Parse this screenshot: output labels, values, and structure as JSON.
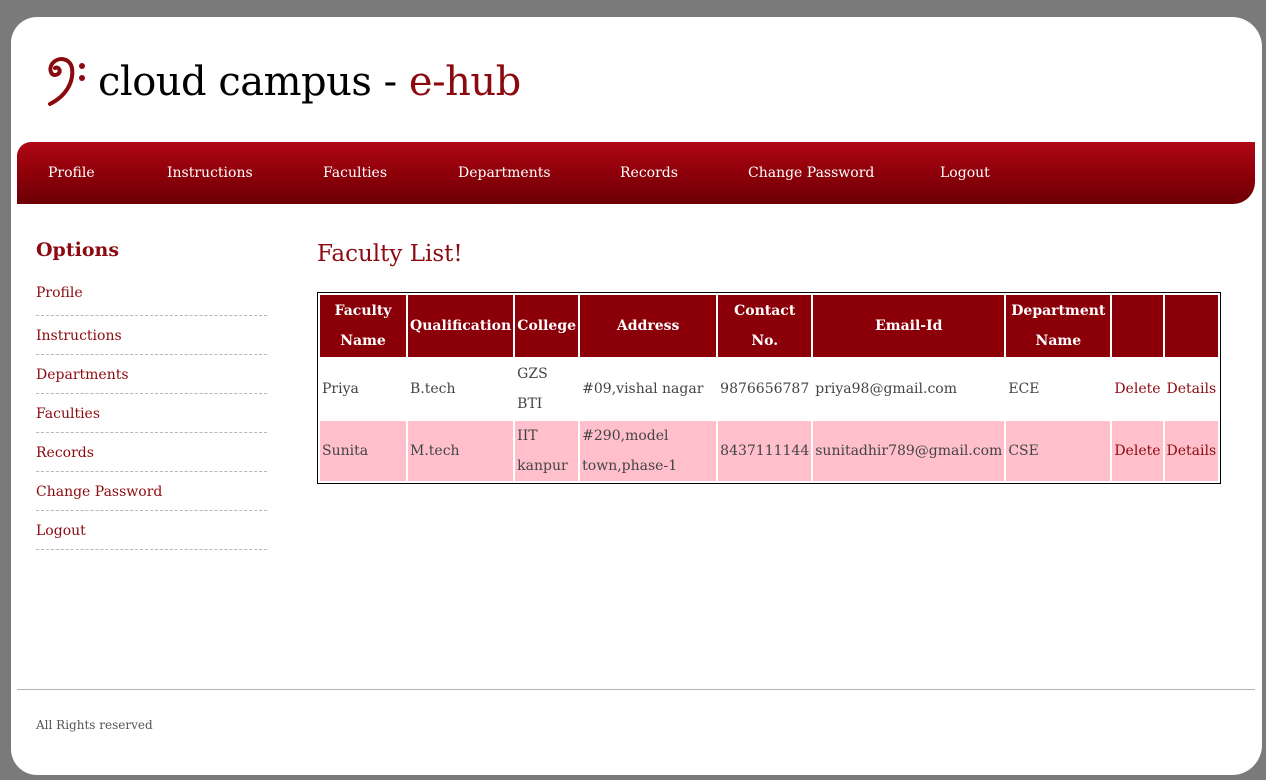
{
  "brand": {
    "name": "cloud campus - ",
    "accent": "e-hub",
    "accent_color": "#8b0a0f",
    "logo_icon": "bass-clef-icon"
  },
  "nav": {
    "items": [
      {
        "label": "Profile"
      },
      {
        "label": "Instructions"
      },
      {
        "label": "Faculties"
      },
      {
        "label": "Departments"
      },
      {
        "label": "Records"
      },
      {
        "label": "Change Password"
      },
      {
        "label": "Logout"
      }
    ]
  },
  "sidebar": {
    "title": "Options",
    "items": [
      {
        "label": "Profile"
      },
      {
        "label": "Instructions"
      },
      {
        "label": "Departments"
      },
      {
        "label": "Faculties"
      },
      {
        "label": "Records"
      },
      {
        "label": "Change Password"
      },
      {
        "label": "Logout"
      }
    ]
  },
  "main": {
    "title": "Faculty List!",
    "table": {
      "headers": {
        "faculty_name_1": "Faculty",
        "faculty_name_2": "Name",
        "qualification": "Qualification",
        "college": "College",
        "address": "Address",
        "contact_1": "Contact",
        "contact_2": "No.",
        "email": "Email-Id",
        "department_1": "Department",
        "department_2": "Name",
        "delete": "",
        "details": ""
      },
      "rows": [
        {
          "name": "Priya",
          "qualification": "B.tech",
          "college": "GZS BTI",
          "address": "#09,vishal nagar",
          "contact": "9876656787",
          "email": "priya98@gmail.com",
          "department": "ECE",
          "delete": "Delete",
          "details": "Details"
        },
        {
          "name": "Sunita",
          "qualification": "M.tech",
          "college_1": "IIT",
          "college_2": "kanpur",
          "address_1": "#290,model",
          "address_2": "town,phase-1",
          "contact": "8437111144",
          "email": "sunitadhir789@gmail.com",
          "department": "CSE",
          "delete": "Delete",
          "details": "Details"
        }
      ]
    }
  },
  "footer": {
    "text": "All Rights reserved"
  },
  "colors": {
    "primary": "#8b0008",
    "row_alt": "#ffc0cb"
  }
}
